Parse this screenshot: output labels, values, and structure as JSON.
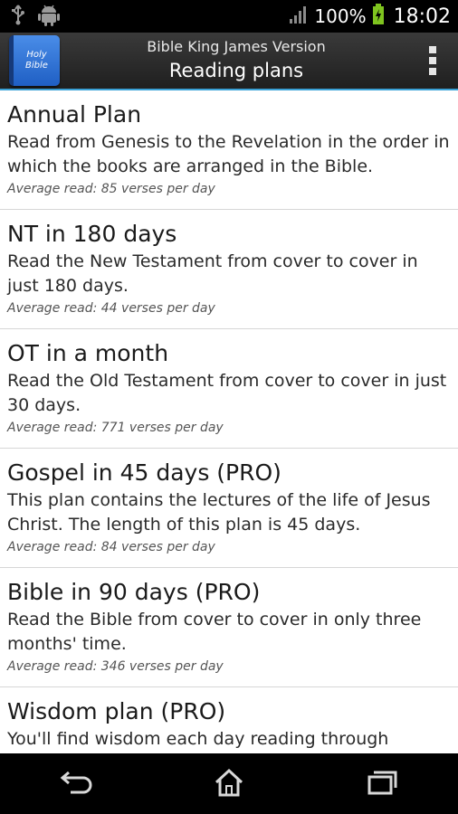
{
  "status_bar": {
    "battery": "100%",
    "time": "18:02",
    "icons": [
      "usb-icon",
      "android-icon",
      "signal-icon",
      "battery-icon"
    ]
  },
  "action_bar": {
    "icon_line1": "Holy",
    "icon_line2": "Bible",
    "subtitle": "Bible King James Version",
    "title": "Reading plans"
  },
  "plans": [
    {
      "title": "Annual Plan",
      "description": "Read from Genesis to the Revelation in the order in which the books are arranged in the Bible.",
      "average": "Average read: 85 verses per day"
    },
    {
      "title": "NT in 180 days",
      "description": "Read the New Testament from cover to cover in just 180 days.",
      "average": "Average read: 44 verses per day"
    },
    {
      "title": "OT in a month",
      "description": "Read the Old Testament from cover to cover in just 30 days.",
      "average": "Average read: 771 verses per day"
    },
    {
      "title": "Gospel in 45 days (PRO)",
      "description": "This plan contains the lectures of the life of Jesus Christ. The length of this plan is 45 days.",
      "average": "Average read: 84 verses per day"
    },
    {
      "title": "Bible in 90 days (PRO)",
      "description": "Read the Bible from cover to cover in only three months' time.",
      "average": "Average read: 346 verses per day"
    },
    {
      "title": "Wisdom plan (PRO)",
      "description": "You'll find wisdom each day reading through",
      "average": ""
    }
  ],
  "nav_bar": {
    "icons": [
      "back-icon",
      "home-icon",
      "recent-apps-icon"
    ]
  },
  "colors": {
    "accent": "#3aa1d6",
    "action_bar": "#2b2b2b",
    "status_bar": "#000000"
  }
}
